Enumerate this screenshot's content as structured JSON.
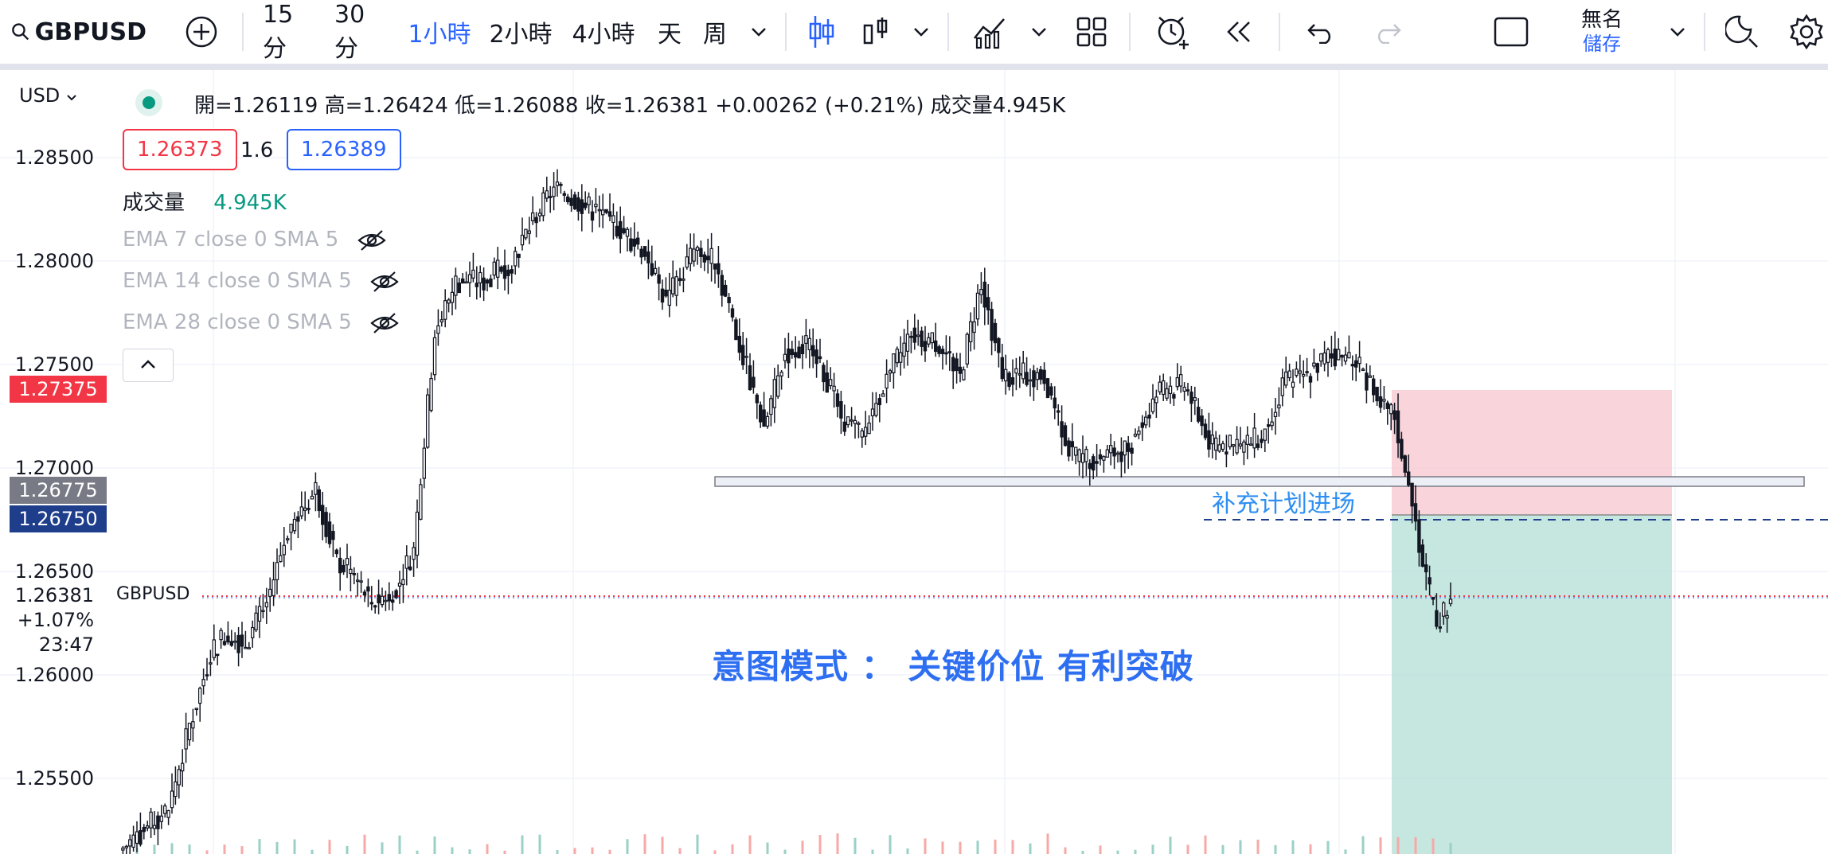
{
  "toolbar": {
    "symbol": "GBPUSD",
    "intervals": [
      "15分",
      "30分",
      "1小時",
      "2小時",
      "4小時",
      "天",
      "周"
    ],
    "active_interval": "1小時",
    "layout_name": "無名",
    "layout_save": "儲存",
    "icons": [
      "search-icon",
      "add-symbol-icon",
      "chevron-down-icon",
      "candles-icon",
      "bar-style-icon",
      "indicators-icon",
      "templates-icon",
      "alert-icon",
      "replay-icon",
      "undo-icon",
      "redo-icon",
      "layout-icon",
      "quick-search-icon",
      "settings-icon"
    ]
  },
  "legend": {
    "currency": "USD",
    "ohlc_text": "開=1.26119  高=1.26424  低=1.26088  收=1.26381  +0.00262 (+0.21%)  成交量4.945K",
    "bid": "1.26373",
    "spread": "1.6",
    "ask": "1.26389",
    "volume_label": "成交量",
    "volume_value": "4.945K",
    "indicators": [
      "EMA 7 close 0 SMA 5",
      "EMA 14 close 0 SMA 5",
      "EMA 28 close 0 SMA 5"
    ]
  },
  "price_axis": {
    "ticks": [
      "1.28500",
      "1.28000",
      "1.27500",
      "1.27000",
      "1.26500",
      "1.26000",
      "1.25500"
    ],
    "tag_red": "1.27375",
    "tag_gray": "1.26775",
    "tag_blue": "1.26750",
    "current_price": "1.26381",
    "change_pct": "+1.07%",
    "countdown": "23:47",
    "symbol_label": "GBPUSD"
  },
  "annotations": {
    "entry_note": "补充计划进场",
    "headline": "意图模式 ： 关键价位 有利突破"
  },
  "colors": {
    "accent": "#2962ff",
    "down": "#f23645",
    "up": "#089981",
    "stop_zone": "#f8c6cf",
    "target_zone": "#b2dfd5",
    "annotation": "#2e6ff2"
  },
  "chart_data": {
    "type": "candlestick",
    "symbol": "GBPUSD",
    "interval": "1h",
    "ylim": [
      1.2515,
      1.2885
    ],
    "last_bar": {
      "open": 1.26119,
      "high": 1.26424,
      "low": 1.26088,
      "close": 1.26381,
      "volume": "4.945K"
    },
    "key_level": 1.2695,
    "position": {
      "stop": 1.27375,
      "entry": 1.26775,
      "target_below": 1.2515
    },
    "close_path": [
      [
        0,
        1.2515
      ],
      [
        14,
        1.2535
      ],
      [
        20,
        1.2575
      ],
      [
        26,
        1.261
      ],
      [
        30,
        1.262
      ],
      [
        36,
        1.2615
      ],
      [
        42,
        1.2635
      ],
      [
        48,
        1.267
      ],
      [
        56,
        1.269
      ],
      [
        62,
        1.2655
      ],
      [
        66,
        1.265
      ],
      [
        72,
        1.2635
      ],
      [
        78,
        1.264
      ],
      [
        84,
        1.266
      ],
      [
        90,
        1.2765
      ],
      [
        96,
        1.279
      ],
      [
        104,
        1.279
      ],
      [
        112,
        1.28
      ],
      [
        118,
        1.282
      ],
      [
        124,
        1.2835
      ],
      [
        130,
        1.283
      ],
      [
        140,
        1.282
      ],
      [
        150,
        1.2805
      ],
      [
        156,
        1.278
      ],
      [
        164,
        1.2805
      ],
      [
        170,
        1.28
      ],
      [
        176,
        1.2765
      ],
      [
        184,
        1.272
      ],
      [
        190,
        1.2755
      ],
      [
        198,
        1.276
      ],
      [
        206,
        1.2725
      ],
      [
        212,
        1.2715
      ],
      [
        218,
        1.274
      ],
      [
        226,
        1.2765
      ],
      [
        234,
        1.276
      ],
      [
        240,
        1.2745
      ],
      [
        246,
        1.279
      ],
      [
        252,
        1.2745
      ],
      [
        258,
        1.2745
      ],
      [
        264,
        1.2745
      ],
      [
        272,
        1.2705
      ],
      [
        280,
        1.2705
      ],
      [
        288,
        1.271
      ],
      [
        296,
        1.2735
      ],
      [
        304,
        1.274
      ],
      [
        312,
        1.271
      ],
      [
        320,
        1.271
      ],
      [
        326,
        1.2715
      ],
      [
        332,
        1.274
      ],
      [
        338,
        1.2745
      ],
      [
        346,
        1.2755
      ],
      [
        354,
        1.275
      ],
      [
        360,
        1.273
      ],
      [
        364,
        1.2725
      ],
      [
        368,
        1.269
      ],
      [
        372,
        1.2655
      ],
      [
        376,
        1.2625
      ],
      [
        378,
        1.263
      ],
      [
        380,
        1.2635
      ]
    ]
  }
}
